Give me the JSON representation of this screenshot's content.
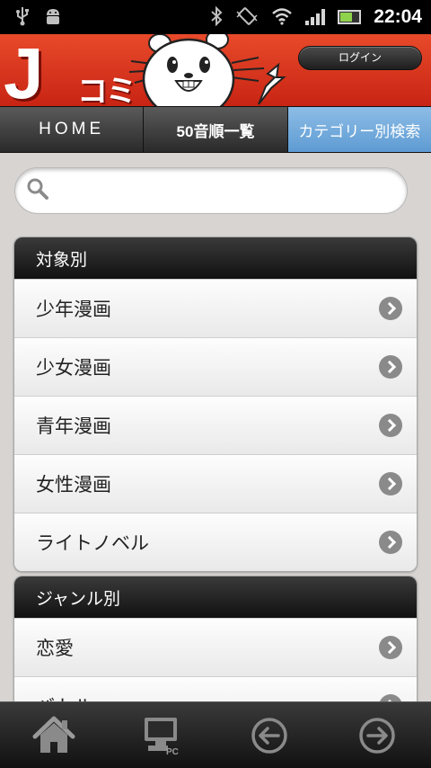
{
  "status_bar": {
    "time": "22:04",
    "icons": [
      "usb-icon",
      "android-debug-icon",
      "bluetooth-icon",
      "vibrate-icon",
      "wifi-icon",
      "signal-icon",
      "battery-icon"
    ]
  },
  "header": {
    "logo_j": "J",
    "logo_komi": "コミ",
    "login_label": "ログイン"
  },
  "nav": {
    "tabs": [
      {
        "label": "HOME"
      },
      {
        "label": "50音順一覧"
      },
      {
        "label": "カテゴリー別検索"
      }
    ],
    "active_tab": "カテゴリー別検索"
  },
  "search": {
    "placeholder": "",
    "value": ""
  },
  "groups": [
    {
      "title": "対象別",
      "items": [
        "少年漫画",
        "少女漫画",
        "青年漫画",
        "女性漫画",
        "ライトノベル"
      ]
    },
    {
      "title": "ジャンル別",
      "items": [
        "恋愛",
        "バトル"
      ]
    }
  ],
  "bottom_bar": {
    "icons": [
      "home-icon",
      "pc-view-icon",
      "back-arrow-icon",
      "forward-arrow-icon"
    ],
    "pc_label": "PC"
  },
  "colors": {
    "header_red": "#d8301c",
    "active_tab_blue": "#6fa8dc",
    "group_header": "#1e1e1e"
  }
}
